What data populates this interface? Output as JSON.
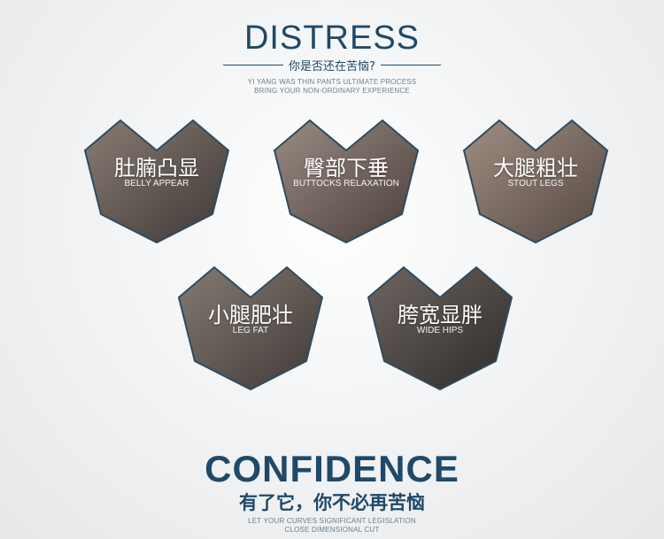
{
  "header": {
    "title": "DISTRESS",
    "subtitle_cn": "你是否还在苦恼?",
    "subtitle_en_1": "YI YANG WAS THIN PANTS ULTIMATE PROCESS",
    "subtitle_en_2": "BRING YOUR NON-ORDINARY EXPERIENCE"
  },
  "problems": [
    {
      "cn": "肚腩凸显",
      "en": "BELLY APPEAR"
    },
    {
      "cn": "臀部下垂",
      "en": "BUTTOCKS RELAXATION"
    },
    {
      "cn": "大腿粗壮",
      "en": "STOUT LEGS"
    },
    {
      "cn": "小腿肥壮",
      "en": "LEG FAT"
    },
    {
      "cn": "胯宽显胖",
      "en": "WIDE HIPS"
    }
  ],
  "footer": {
    "title": "CONFIDENCE",
    "cn": "有了它，你不必再苦恼",
    "en_1": "LET YOUR CURVES SIGNIFICANT LEGISLATION",
    "en_2": "CLOSE DIMENSIONAL CUT"
  },
  "colors": {
    "accent": "#1f4968",
    "heart_outline": "#2e4b60",
    "heart_fill_dark": "#4a4340",
    "heart_fill_light": "#8a7a72"
  }
}
